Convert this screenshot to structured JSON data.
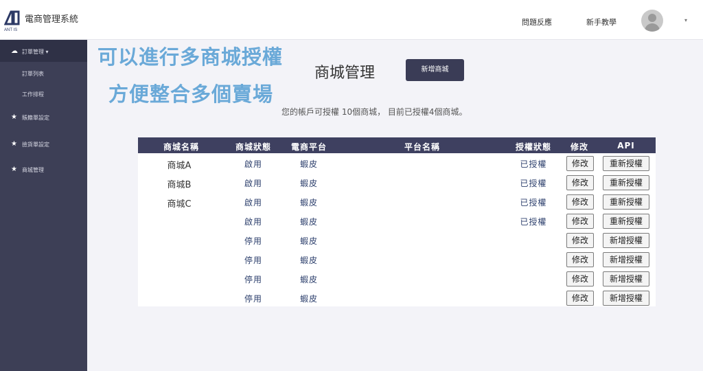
{
  "header": {
    "app_title": "電商管理系統",
    "logo_text": "ANT IS",
    "links": {
      "feedback": "問題反應",
      "tutorial": "新手教學"
    }
  },
  "sidebar": {
    "items": [
      {
        "label": "訂單管理 ▾",
        "icon": "cloud-download-icon"
      },
      {
        "label": "訂單列表",
        "icon": ""
      },
      {
        "label": "工作排程",
        "icon": ""
      },
      {
        "label": "賬籍單設定",
        "icon": "star-icon"
      },
      {
        "label": "撿貨單設定",
        "icon": "star-icon"
      },
      {
        "label": "商城管理",
        "icon": "star-icon"
      }
    ]
  },
  "promo": {
    "line1": "可以進行多商城授權",
    "line2": "方便整合多個賣場"
  },
  "main": {
    "title": "商城管理",
    "add_button": "新增商城",
    "notice": "您的帳戶可授權 10個商城， 目前已授權4個商城。"
  },
  "table": {
    "headers": [
      "商城名稱",
      "商城狀態",
      "電商平台",
      "平台名稱",
      "授權狀態",
      "修改",
      "API"
    ],
    "rows": [
      {
        "name": "商城A",
        "status": "啟用",
        "platform": "蝦皮",
        "platform_name": "",
        "auth": "已授權",
        "edit": "修改",
        "api": "重新授權"
      },
      {
        "name": "商城B",
        "status": "啟用",
        "platform": "蝦皮",
        "platform_name": "",
        "auth": "已授權",
        "edit": "修改",
        "api": "重新授權"
      },
      {
        "name": "商城C",
        "status": "啟用",
        "platform": "蝦皮",
        "platform_name": "",
        "auth": "已授權",
        "edit": "修改",
        "api": "重新授權"
      },
      {
        "name": "",
        "status": "啟用",
        "platform": "蝦皮",
        "platform_name": "",
        "auth": "已授權",
        "edit": "修改",
        "api": "重新授權"
      },
      {
        "name": "",
        "status": "停用",
        "platform": "蝦皮",
        "platform_name": "",
        "auth": "",
        "edit": "修改",
        "api": "新增授權"
      },
      {
        "name": "",
        "status": "停用",
        "platform": "蝦皮",
        "platform_name": "",
        "auth": "",
        "edit": "修改",
        "api": "新增授權"
      },
      {
        "name": "",
        "status": "停用",
        "platform": "蝦皮",
        "platform_name": "",
        "auth": "",
        "edit": "修改",
        "api": "新增授權"
      },
      {
        "name": "",
        "status": "停用",
        "platform": "蝦皮",
        "platform_name": "",
        "auth": "",
        "edit": "修改",
        "api": "新增授權"
      }
    ]
  },
  "colors": {
    "sidebar": "#3d3f56",
    "table_header": "#3e4060",
    "accent_button": "#3a3c56",
    "promo_text": "#6aa9d8",
    "status_text": "#2c3f6c"
  }
}
